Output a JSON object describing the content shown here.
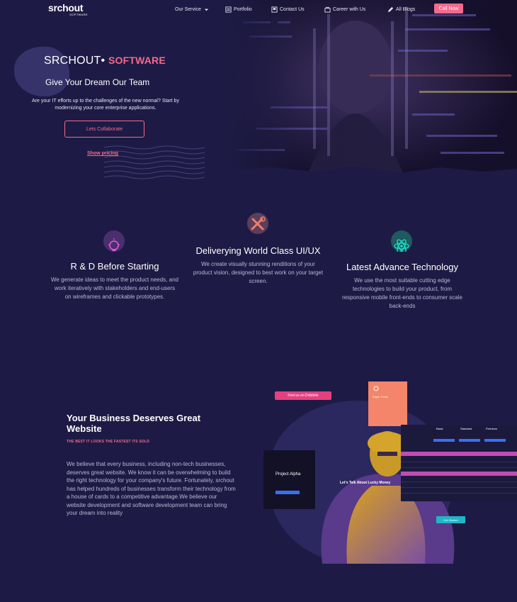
{
  "header": {
    "logo_text": "srchout",
    "logo_sub": "SOFTWARE",
    "nav": [
      {
        "label": "Our Service",
        "icon": "chevron-down-icon"
      },
      {
        "label": "Portfolio",
        "icon": "portfolio-icon"
      },
      {
        "label": "Contact Us",
        "icon": "contact-icon"
      },
      {
        "label": "Career with Us",
        "icon": "career-icon"
      },
      {
        "label": "All Blogs",
        "icon": "pen-icon"
      }
    ],
    "cta": "Call Now"
  },
  "hero": {
    "title": "SRCHOUT•",
    "title_accent": "SOFTWARE",
    "subtitle": "Give Your Dream Our Team",
    "description": "Are your IT efforts up to the challenges of the new normal? Start by modernizing your core enterprise applications.",
    "button": "Lets Collaborate",
    "link": "Show pricing"
  },
  "features": [
    {
      "title": "R & D Before Starting",
      "description": "We generate ideas to meet the product needs, and work iteratively with stakeholders and end-users on wireframes and clickable prototypes.",
      "icon": "lightbulb-icon"
    },
    {
      "title": "Deliverying World Class UI/UX",
      "description": "We create visually stunning renditions of your product vision, designed to best work on your target screen.",
      "icon": "tools-icon"
    },
    {
      "title": "Latest Advance Technology",
      "description": "We use the most suitable cutting edge technologies to build your product, from responsive mobile front-ends to consumer scale back-ends",
      "icon": "atom-icon"
    }
  ],
  "business": {
    "title": "Your Business Deserves Great Website",
    "tagline": "THE BEST IT LOOKS THE FASTEST ITS SOLD",
    "body": "We believe that every business, including non-tech businesses, deserves great website. We know it can be overwhelming to build the right technology for your company's future. Fortunately, srchout has helped hundreds of businesses transform their technology from a house of cards to a competitive advantage.We believe our website development and software development team can bring your dream into reality"
  },
  "collage": {
    "pill": "Find us on Dribbble",
    "card_title": "Project Alpha",
    "card_small": "Super Fresh",
    "headline": "Let's Talk About Lucky Money",
    "plans": [
      "Basic",
      "Standard",
      "Premium"
    ],
    "cta": "Get Started"
  },
  "colors": {
    "background": "#1d1b45",
    "accent": "#f46a8c",
    "teal": "#1fb6c7"
  }
}
